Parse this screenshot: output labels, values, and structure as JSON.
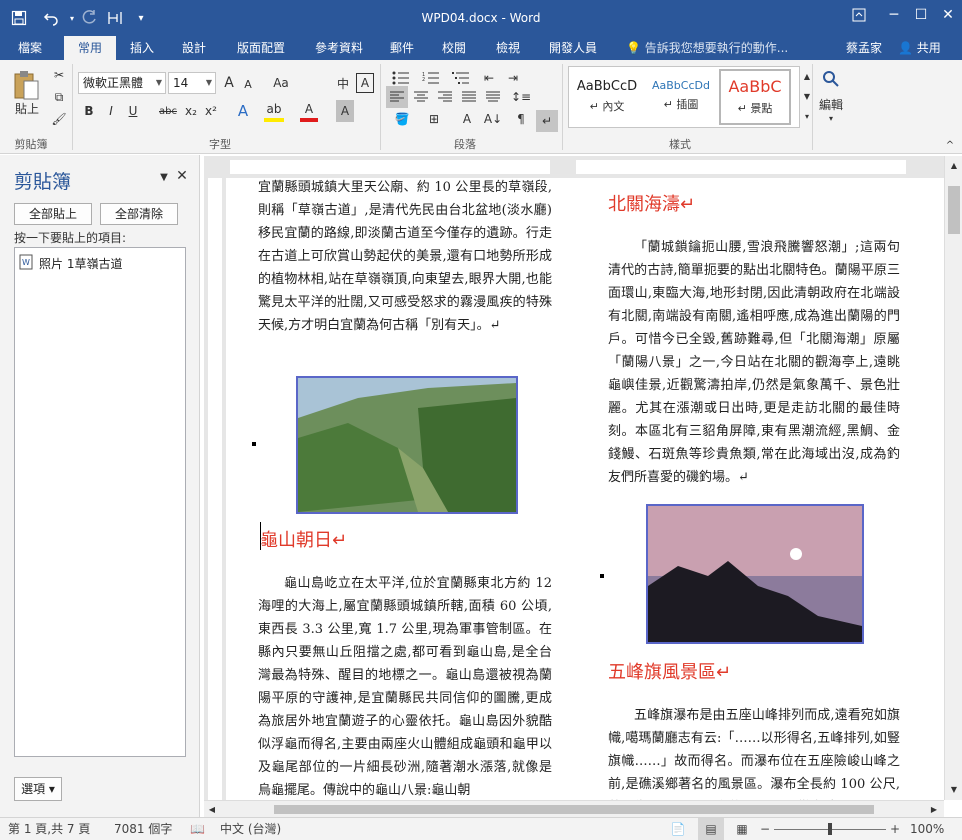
{
  "window": {
    "title": "WPD04.docx - Word",
    "quick_access": {
      "save_icon": "save-icon",
      "undo_icon": "undo-icon",
      "redo_icon": "redo-icon",
      "table_icon": "insert-table-icon",
      "customize": "▾"
    },
    "controls": {
      "ribbon_options": "ribbon-display-icon",
      "minimize": "─",
      "maximize": "☐",
      "close": "✕"
    }
  },
  "ribbon": {
    "tabs": [
      {
        "label": "檔案"
      },
      {
        "label": "常用"
      },
      {
        "label": "插入"
      },
      {
        "label": "設計"
      },
      {
        "label": "版面配置"
      },
      {
        "label": "參考資料"
      },
      {
        "label": "郵件"
      },
      {
        "label": "校閱"
      },
      {
        "label": "檢視"
      },
      {
        "label": "開發人員"
      }
    ],
    "active_tab": "常用",
    "tell_me": "告訴我您想要執行的動作...",
    "user_name": "蔡孟家",
    "share_label": "共用",
    "groups": {
      "clipboard": "剪貼簿",
      "font": "字型",
      "paragraph": "段落",
      "styles": "樣式",
      "editing": "編輯"
    },
    "paste_label": "貼上",
    "font_name": "微軟正黑體",
    "font_size": "14",
    "font_buttons": {
      "grow": "A",
      "shrink": "A",
      "case": "Aa",
      "phonetic": "中",
      "border": "A",
      "bold": "B",
      "italic": "I",
      "underline": "U",
      "strike": "abc",
      "subscript": "x₂",
      "superscript": "x²",
      "effects": "A",
      "highlight": "ab",
      "color": "A",
      "shade": "A"
    },
    "styles": [
      {
        "sample": "AaBbCcD",
        "name": "↵ 內文"
      },
      {
        "sample": "AaBbCcDd",
        "name": "↵ 插圖"
      },
      {
        "sample": "AaBbC",
        "name": "↵ 景點"
      }
    ],
    "accent": "#2b579a"
  },
  "clipboard_pane": {
    "title": "剪貼簿",
    "paste_all": "全部貼上",
    "clear_all": "全部清除",
    "hint": "按一下要貼上的項目:",
    "items": [
      {
        "label": "照片 1草嶺古道"
      }
    ],
    "options": "選項"
  },
  "document": {
    "col1_para1": "宜蘭縣頭城鎮大里天公廟、約 10 公里長的草嶺段,則稱「草嶺古道」,是清代先民由台北盆地(淡水廳)移民宜蘭的路線,即淡蘭古道至今僅存的遺跡。行走在古道上可欣賞山勢起伏的美景,還有口地勢所形成的植物林相,站在草嶺嶺頂,向東望去,眼界大開,也能驚見太平洋的壯闊,又可感受怒求的霧漫風疾的特殊天候,方才明白宜蘭為何古稱「別有天」。↵",
    "heading_guishan": "龜山朝日↵",
    "col1_para2": "龜山島屹立在太平洋,位於宜蘭縣東北方約 12 海哩的大海上,屬宜蘭縣頭城鎮所轄,面積 60 公頃,東西長 3.3 公里,寬 1.7 公里,現為軍事管制區。在縣內只要無山丘阻擋之處,都可看到龜山島,是全台灣最為特殊、醒目的地標之一。龜山島還被視為蘭陽平原的守護神,是宜蘭縣民共同信仰的圖騰,更成為旅居外地宜蘭遊子的心靈依托。龜山島因外貌酷似浮龜而得名,主要由兩座火山體組成龜頭和龜甲以及龜尾部位的一片細長砂洲,隨著潮水漲落,就像是烏龜擺尾。傳說中的龜山八景:龜山朝",
    "heading_beiguan": "北關海濤↵",
    "col2_para1": "「蘭城鎖鑰扼山腰,雪浪飛騰響怒潮」;這兩句清代的古詩,簡單扼要的點出北關特色。蘭陽平原三面環山,東臨大海,地形封閉,因此清朝政府在北端設有北關,南端設有南關,遙相呼應,成為進出蘭陽的門戶。可惜今已全毀,舊跡難尋,但「北關海潮」原屬「蘭陽八景」之一,今日站在北關的觀海亭上,遠眺龜嶼佳景,近觀驚濤拍岸,仍然是氣象萬千、景色壯麗。尤其在漲潮或日出時,更是走訪北關的最佳時刻。本區北有三貂角屏障,東有黑潮流經,黑鯛、金錢鰻、石斑魚等珍貴魚類,常在此海域出沒,成為釣友們所喜愛的磯釣場。↵",
    "heading_wufeng": "五峰旗風景區↵",
    "col2_para2": "五峰旗瀑布是由五座山峰排列而成,遠看宛如旗幟,噶瑪蘭廳志有云:「……以形得名,五峰排列,如豎旗幟……」故而得名。而瀑布位在五座險峻山峰之前,是礁溪鄉著名的風景區。瀑布全長約 100 公尺,共分為三層,上層瀑布約 30 公尺,從岩壁上"
  },
  "status": {
    "page": "第 1 頁,共 7 頁",
    "words": "7081 個字",
    "language": "中文 (台灣)",
    "zoom": "100%",
    "zoom_minus": "−",
    "zoom_plus": "+"
  }
}
